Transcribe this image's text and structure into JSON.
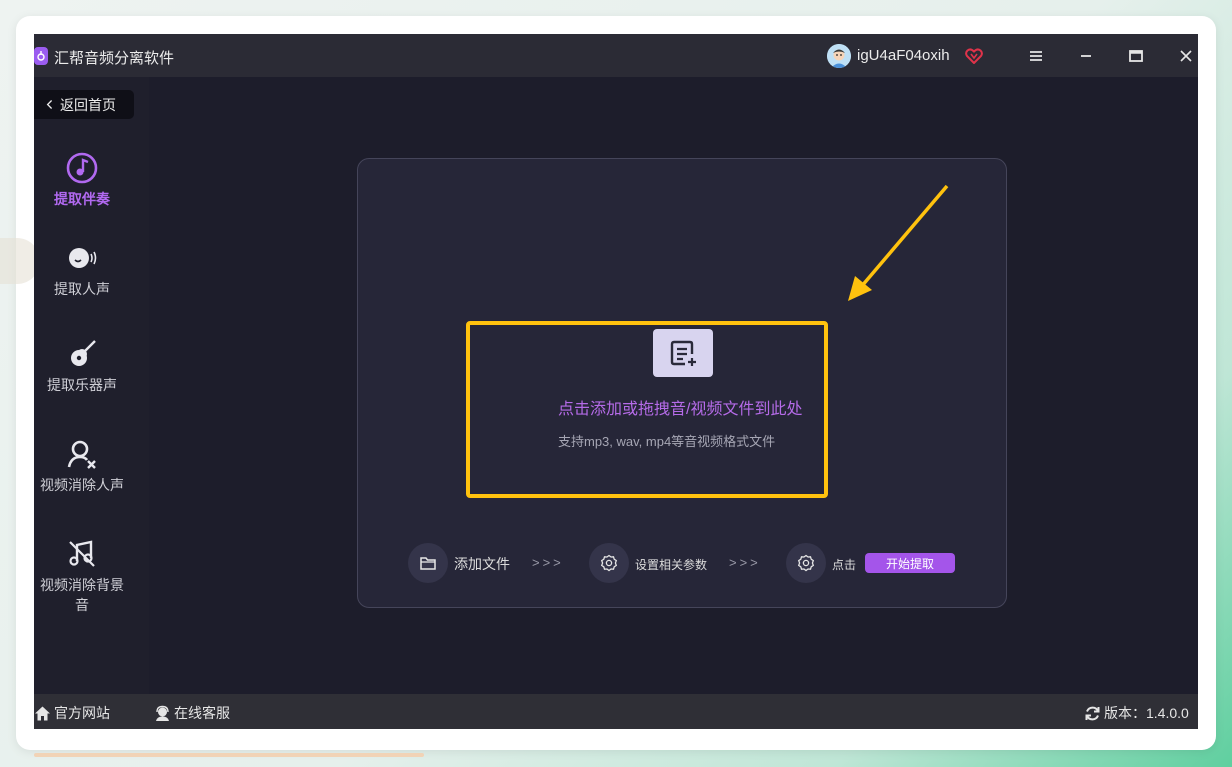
{
  "app": {
    "title": "汇帮音频分离软件",
    "username": "igU4aF04oxih"
  },
  "sidebar": {
    "back_label": "返回首页",
    "items": [
      {
        "label": "提取伴奏",
        "icon": "music-note-icon",
        "active": true
      },
      {
        "label": "提取人声",
        "icon": "voice-icon",
        "active": false
      },
      {
        "label": "提取乐器声",
        "icon": "guitar-icon",
        "active": false
      },
      {
        "label": "视频消除人声",
        "icon": "user-remove-icon",
        "active": false
      },
      {
        "label": "视频消除背景音",
        "icon": "music-off-icon",
        "active": false
      }
    ]
  },
  "main": {
    "drop_title": "点击添加或拖拽音/视频文件到此处",
    "drop_subtitle": "支持mp3, wav, mp4等音视频格式文件",
    "steps": {
      "step1": "添加文件",
      "sep": ">>>",
      "step2": "设置相关参数",
      "step3": "点击",
      "start_button": "开始提取"
    }
  },
  "footer": {
    "website": "官方网站",
    "service": "在线客服",
    "version": "版本：1.4.0.0"
  },
  "colors": {
    "accent": "#a455ea",
    "highlight": "#ffc20e",
    "background": "#1d1d2b"
  }
}
